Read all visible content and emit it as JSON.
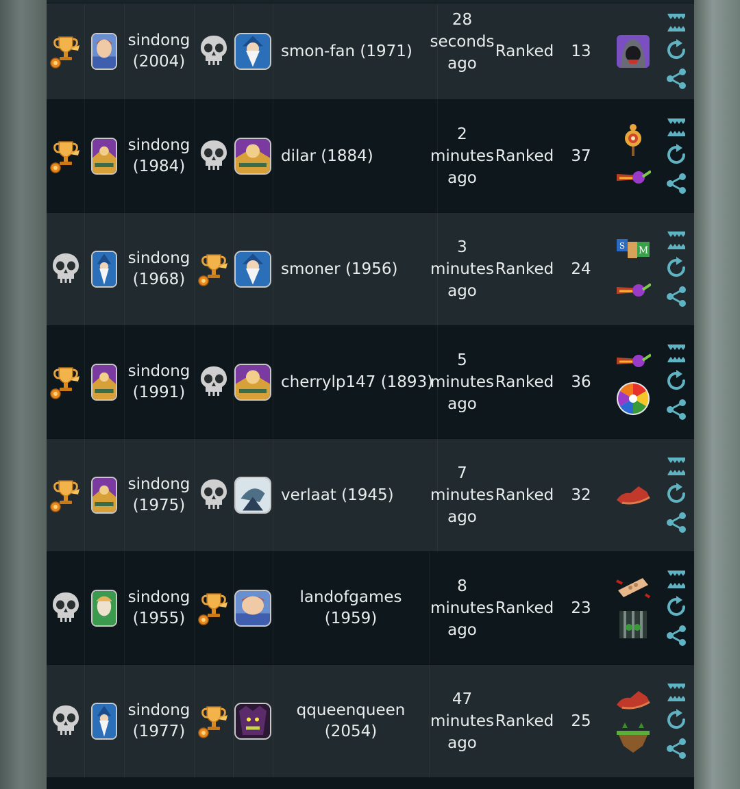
{
  "rows": [
    {
      "p1": {
        "result": "trophy",
        "avatar": "avatar-face-icon",
        "name": "sindong",
        "rating": "(2004)"
      },
      "p2": {
        "result": "skull",
        "avatar": "avatar-wizard-icon",
        "name": "smon-fan (1971)",
        "rating": ""
      },
      "time": [
        "28",
        "seconds",
        "ago"
      ],
      "type": "Ranked",
      "count": "13",
      "games": [
        "hooded-figure-icon"
      ]
    },
    {
      "p1": {
        "result": "trophy",
        "avatar": "avatar-paladin-icon",
        "name": "sindong",
        "rating": "(1984)"
      },
      "p2": {
        "result": "skull",
        "avatar": "avatar-paladin-icon",
        "name": "dilar (1884)",
        "rating": ""
      },
      "time": [
        "2",
        "minutes",
        "ago"
      ],
      "type": "Ranked",
      "count": "37",
      "games": [
        "target-dummy-icon",
        "comet-icon"
      ]
    },
    {
      "p1": {
        "result": "skull",
        "avatar": "avatar-wizard-icon",
        "name": "sindong",
        "rating": "(1968)"
      },
      "p2": {
        "result": "trophy",
        "avatar": "avatar-wizard-icon",
        "name": "smoner (1956)",
        "rating": ""
      },
      "time": [
        "3",
        "minutes",
        "ago"
      ],
      "type": "Ranked",
      "count": "24",
      "games": [
        "letter-blocks-icon",
        "comet-icon"
      ]
    },
    {
      "p1": {
        "result": "trophy",
        "avatar": "avatar-paladin-icon",
        "name": "sindong",
        "rating": "(1991)"
      },
      "p2": {
        "result": "skull",
        "avatar": "avatar-paladin-icon",
        "name": "cherrylp147 (1893)",
        "rating": ""
      },
      "time": [
        "5",
        "minutes",
        "ago"
      ],
      "type": "Ranked",
      "count": "36",
      "games": [
        "comet-icon",
        "trivia-wheel-icon"
      ]
    },
    {
      "p1": {
        "result": "trophy",
        "avatar": "avatar-paladin-icon",
        "name": "sindong",
        "rating": "(1975)"
      },
      "p2": {
        "result": "skull",
        "avatar": "avatar-shark-icon",
        "name": "verlaat (1945)",
        "rating": ""
      },
      "time": [
        "7",
        "minutes",
        "ago"
      ],
      "type": "Ranked",
      "count": "32",
      "games": [
        "red-shoe-icon"
      ]
    },
    {
      "p1": {
        "result": "skull",
        "avatar": "avatar-elf-icon",
        "name": "sindong",
        "rating": "(1955)"
      },
      "p2": {
        "result": "trophy",
        "avatar": "avatar-face-icon",
        "name": "landofgames",
        "rating": "(1959)"
      },
      "time": [
        "8",
        "minutes",
        "ago"
      ],
      "type": "Ranked",
      "count": "23",
      "games": [
        "bandage-icon",
        "cage-icon"
      ]
    },
    {
      "p1": {
        "result": "skull",
        "avatar": "avatar-wizard-icon",
        "name": "sindong",
        "rating": "(1977)"
      },
      "p2": {
        "result": "trophy",
        "avatar": "avatar-villain-icon",
        "name": "qqueenqueen",
        "rating": "(2054)"
      },
      "time": [
        "47",
        "minutes",
        "ago"
      ],
      "type": "Ranked",
      "count": "25",
      "games": [
        "red-shoe-icon",
        "floating-island-icon"
      ]
    }
  ],
  "colors": {
    "accent": "#5fb3c2",
    "trophy": "#e7a23b",
    "skull": "#c9c9c9",
    "row_dark": "#0e171c",
    "row_light": "#212a2e"
  }
}
